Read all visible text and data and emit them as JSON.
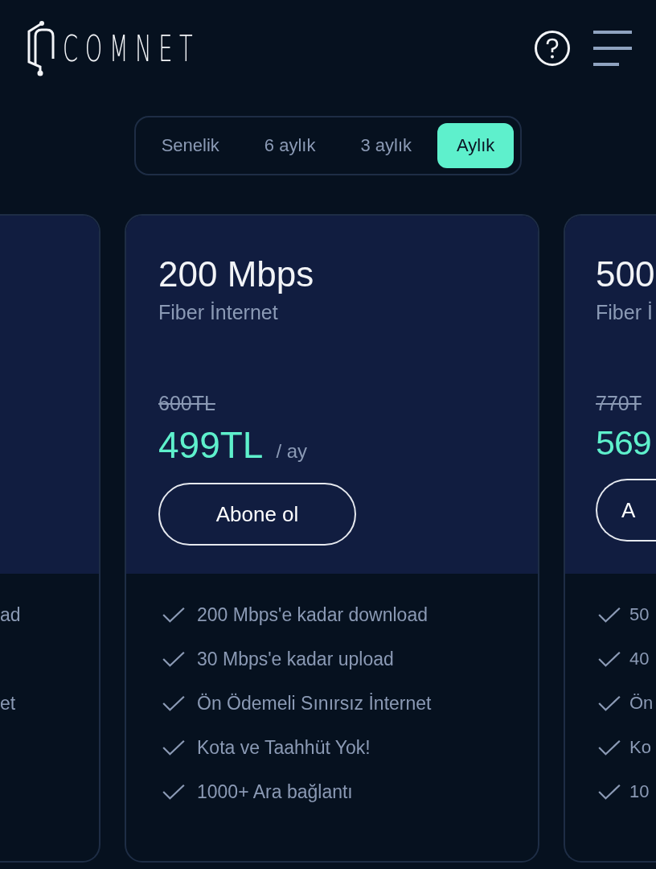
{
  "header": {
    "logo": "COMNET"
  },
  "billing_tabs": [
    {
      "label": "Senelik",
      "selected": false
    },
    {
      "label": "6 aylık",
      "selected": false
    },
    {
      "label": "3 aylık",
      "selected": false
    },
    {
      "label": "Aylık",
      "selected": true
    }
  ],
  "plans": [
    {
      "kind": "left-edge",
      "features": [
        "ad",
        "et"
      ]
    },
    {
      "kind": "full",
      "title": "200 Mbps",
      "subtitle": "Fiber İnternet",
      "old_price": "600TL",
      "price": "499TL",
      "period": "/ ay",
      "button": "Abone ol",
      "features": [
        "200 Mbps'e kadar download",
        "30 Mbps'e kadar upload",
        "Ön Ödemeli Sınırsız İnternet",
        "Kota ve Taahhüt Yok!",
        "1000+ Ara bağlantı"
      ]
    },
    {
      "kind": "right-edge",
      "title": "500",
      "subtitle": "Fiber İ",
      "old_price": "770T",
      "price": "569",
      "button": "A",
      "features": [
        "50",
        "40",
        "Ön",
        "Ko",
        "10"
      ]
    }
  ]
}
